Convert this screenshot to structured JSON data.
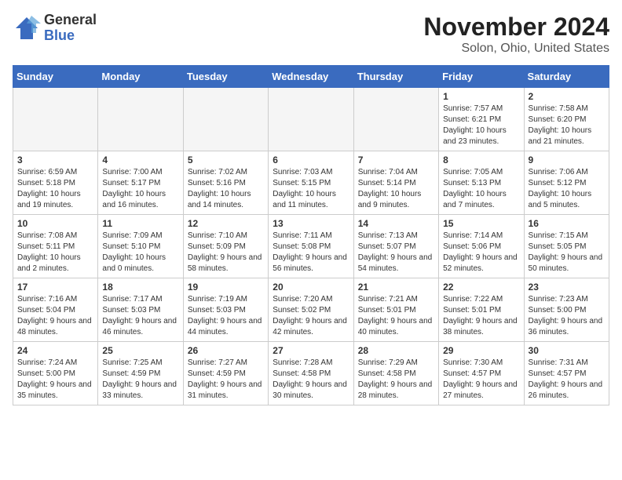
{
  "header": {
    "logo_general": "General",
    "logo_blue": "Blue",
    "month_title": "November 2024",
    "location": "Solon, Ohio, United States"
  },
  "days_of_week": [
    "Sunday",
    "Monday",
    "Tuesday",
    "Wednesday",
    "Thursday",
    "Friday",
    "Saturday"
  ],
  "weeks": [
    [
      {
        "day": "",
        "info": ""
      },
      {
        "day": "",
        "info": ""
      },
      {
        "day": "",
        "info": ""
      },
      {
        "day": "",
        "info": ""
      },
      {
        "day": "",
        "info": ""
      },
      {
        "day": "1",
        "info": "Sunrise: 7:57 AM\nSunset: 6:21 PM\nDaylight: 10 hours\nand 23 minutes."
      },
      {
        "day": "2",
        "info": "Sunrise: 7:58 AM\nSunset: 6:20 PM\nDaylight: 10 hours\nand 21 minutes."
      }
    ],
    [
      {
        "day": "3",
        "info": "Sunrise: 6:59 AM\nSunset: 5:18 PM\nDaylight: 10 hours\nand 19 minutes."
      },
      {
        "day": "4",
        "info": "Sunrise: 7:00 AM\nSunset: 5:17 PM\nDaylight: 10 hours\nand 16 minutes."
      },
      {
        "day": "5",
        "info": "Sunrise: 7:02 AM\nSunset: 5:16 PM\nDaylight: 10 hours\nand 14 minutes."
      },
      {
        "day": "6",
        "info": "Sunrise: 7:03 AM\nSunset: 5:15 PM\nDaylight: 10 hours\nand 11 minutes."
      },
      {
        "day": "7",
        "info": "Sunrise: 7:04 AM\nSunset: 5:14 PM\nDaylight: 10 hours\nand 9 minutes."
      },
      {
        "day": "8",
        "info": "Sunrise: 7:05 AM\nSunset: 5:13 PM\nDaylight: 10 hours\nand 7 minutes."
      },
      {
        "day": "9",
        "info": "Sunrise: 7:06 AM\nSunset: 5:12 PM\nDaylight: 10 hours\nand 5 minutes."
      }
    ],
    [
      {
        "day": "10",
        "info": "Sunrise: 7:08 AM\nSunset: 5:11 PM\nDaylight: 10 hours\nand 2 minutes."
      },
      {
        "day": "11",
        "info": "Sunrise: 7:09 AM\nSunset: 5:10 PM\nDaylight: 10 hours\nand 0 minutes."
      },
      {
        "day": "12",
        "info": "Sunrise: 7:10 AM\nSunset: 5:09 PM\nDaylight: 9 hours\nand 58 minutes."
      },
      {
        "day": "13",
        "info": "Sunrise: 7:11 AM\nSunset: 5:08 PM\nDaylight: 9 hours\nand 56 minutes."
      },
      {
        "day": "14",
        "info": "Sunrise: 7:13 AM\nSunset: 5:07 PM\nDaylight: 9 hours\nand 54 minutes."
      },
      {
        "day": "15",
        "info": "Sunrise: 7:14 AM\nSunset: 5:06 PM\nDaylight: 9 hours\nand 52 minutes."
      },
      {
        "day": "16",
        "info": "Sunrise: 7:15 AM\nSunset: 5:05 PM\nDaylight: 9 hours\nand 50 minutes."
      }
    ],
    [
      {
        "day": "17",
        "info": "Sunrise: 7:16 AM\nSunset: 5:04 PM\nDaylight: 9 hours\nand 48 minutes."
      },
      {
        "day": "18",
        "info": "Sunrise: 7:17 AM\nSunset: 5:03 PM\nDaylight: 9 hours\nand 46 minutes."
      },
      {
        "day": "19",
        "info": "Sunrise: 7:19 AM\nSunset: 5:03 PM\nDaylight: 9 hours\nand 44 minutes."
      },
      {
        "day": "20",
        "info": "Sunrise: 7:20 AM\nSunset: 5:02 PM\nDaylight: 9 hours\nand 42 minutes."
      },
      {
        "day": "21",
        "info": "Sunrise: 7:21 AM\nSunset: 5:01 PM\nDaylight: 9 hours\nand 40 minutes."
      },
      {
        "day": "22",
        "info": "Sunrise: 7:22 AM\nSunset: 5:01 PM\nDaylight: 9 hours\nand 38 minutes."
      },
      {
        "day": "23",
        "info": "Sunrise: 7:23 AM\nSunset: 5:00 PM\nDaylight: 9 hours\nand 36 minutes."
      }
    ],
    [
      {
        "day": "24",
        "info": "Sunrise: 7:24 AM\nSunset: 5:00 PM\nDaylight: 9 hours\nand 35 minutes."
      },
      {
        "day": "25",
        "info": "Sunrise: 7:25 AM\nSunset: 4:59 PM\nDaylight: 9 hours\nand 33 minutes."
      },
      {
        "day": "26",
        "info": "Sunrise: 7:27 AM\nSunset: 4:59 PM\nDaylight: 9 hours\nand 31 minutes."
      },
      {
        "day": "27",
        "info": "Sunrise: 7:28 AM\nSunset: 4:58 PM\nDaylight: 9 hours\nand 30 minutes."
      },
      {
        "day": "28",
        "info": "Sunrise: 7:29 AM\nSunset: 4:58 PM\nDaylight: 9 hours\nand 28 minutes."
      },
      {
        "day": "29",
        "info": "Sunrise: 7:30 AM\nSunset: 4:57 PM\nDaylight: 9 hours\nand 27 minutes."
      },
      {
        "day": "30",
        "info": "Sunrise: 7:31 AM\nSunset: 4:57 PM\nDaylight: 9 hours\nand 26 minutes."
      }
    ]
  ]
}
